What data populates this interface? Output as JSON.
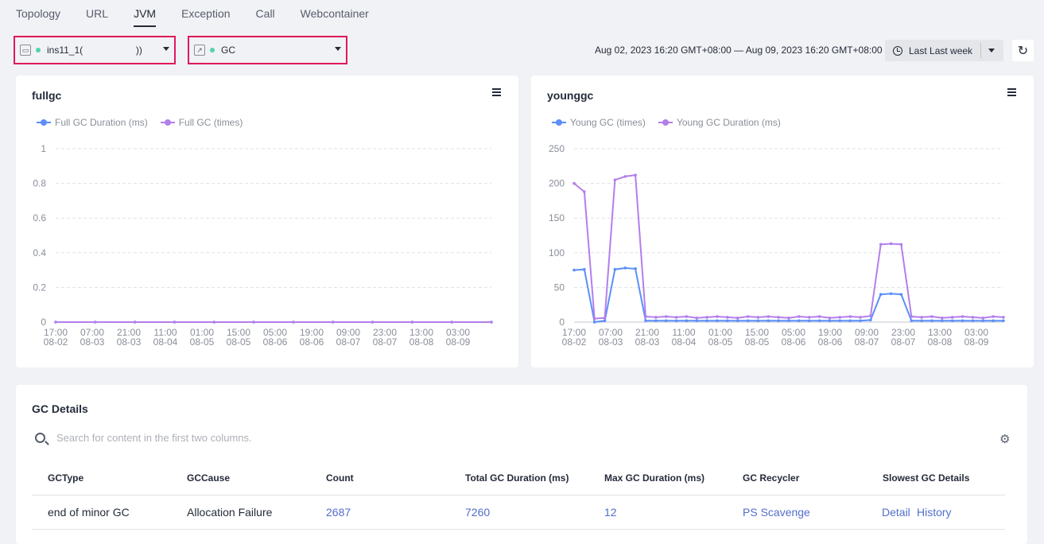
{
  "tabs": [
    {
      "label": "Topology"
    },
    {
      "label": "URL"
    },
    {
      "label": "JVM"
    },
    {
      "label": "Exception"
    },
    {
      "label": "Call"
    },
    {
      "label": "Webcontainer"
    }
  ],
  "active_tab": "JVM",
  "instance_select": {
    "value": "ins11_1(                    ))"
  },
  "metric_select": {
    "value": "GC"
  },
  "time": {
    "range": "Aug 02, 2023 16:20 GMT+08:00 — Aug 09, 2023 16:20 GMT+08:00",
    "preset": "Last Last week"
  },
  "chart_data": [
    {
      "type": "line",
      "title": "fullgc",
      "ylim": [
        0,
        1
      ],
      "yticks": [
        "0",
        "0.2",
        "0.4",
        "0.6",
        "0.8",
        "1"
      ],
      "xtick_times": [
        "17:00",
        "07:00",
        "21:00",
        "11:00",
        "01:00",
        "15:00",
        "05:00",
        "19:00",
        "09:00",
        "23:00",
        "13:00",
        "03:00"
      ],
      "xtick_dates": [
        "08-02",
        "08-03",
        "08-03",
        "08-04",
        "08-05",
        "08-05",
        "08-06",
        "08-06",
        "08-07",
        "08-07",
        "08-08",
        "08-09"
      ],
      "series": [
        {
          "name": "Full GC Duration (ms)",
          "color": "#5b8ff9",
          "values": [
            0,
            0,
            0,
            0,
            0,
            0,
            0,
            0,
            0,
            0,
            0,
            0
          ]
        },
        {
          "name": "Full GC (times)",
          "color": "#b37feb",
          "values": [
            0,
            0,
            0,
            0,
            0,
            0,
            0,
            0,
            0,
            0,
            0,
            0
          ]
        }
      ]
    },
    {
      "type": "line",
      "title": "younggc",
      "ylim": [
        0,
        250
      ],
      "yticks": [
        "0",
        "50",
        "100",
        "150",
        "200",
        "250"
      ],
      "xtick_times": [
        "17:00",
        "07:00",
        "21:00",
        "11:00",
        "01:00",
        "15:00",
        "05:00",
        "19:00",
        "09:00",
        "23:00",
        "13:00",
        "03:00"
      ],
      "xtick_dates": [
        "08-02",
        "08-03",
        "08-03",
        "08-04",
        "08-05",
        "08-05",
        "08-06",
        "08-06",
        "08-07",
        "08-07",
        "08-08",
        "08-09"
      ],
      "x_hours": [
        0,
        4,
        8,
        12,
        16,
        20,
        24,
        28,
        32,
        36,
        40,
        44,
        48,
        52,
        56,
        60,
        64,
        68,
        72,
        76,
        80,
        84,
        88,
        92,
        96,
        100,
        104,
        108,
        112,
        116,
        120,
        124,
        128,
        132,
        136,
        140,
        144,
        148,
        152,
        156,
        160,
        164,
        168
      ],
      "series": [
        {
          "name": "Young GC (times)",
          "color": "#5b8ff9",
          "values": [
            75,
            76,
            0,
            2,
            76,
            78,
            77,
            2,
            2,
            2,
            2,
            2,
            2,
            2,
            2,
            2,
            2,
            2,
            2,
            2,
            2,
            2,
            2,
            2,
            2,
            2,
            2,
            2,
            2,
            3,
            40,
            41,
            40,
            2,
            2,
            2,
            2,
            2,
            2,
            2,
            2,
            2,
            2
          ]
        },
        {
          "name": "Young GC Duration (ms)",
          "color": "#b37feb",
          "values": [
            200,
            188,
            5,
            6,
            205,
            210,
            212,
            8,
            7,
            8,
            7,
            8,
            6,
            7,
            8,
            7,
            6,
            8,
            7,
            8,
            7,
            6,
            8,
            7,
            8,
            6,
            7,
            8,
            7,
            9,
            112,
            113,
            112,
            8,
            7,
            8,
            6,
            7,
            8,
            7,
            6,
            8,
            7
          ]
        }
      ]
    }
  ],
  "gc_details": {
    "title": "GC Details",
    "search_placeholder": "Search for content in the first two columns.",
    "columns": [
      "GCType",
      "GCCause",
      "Count",
      "Total GC Duration (ms)",
      "Max GC Duration (ms)",
      "GC Recycler",
      "Slowest GC Details"
    ],
    "rows": [
      {
        "gctype": "end of minor GC",
        "gccause": "Allocation Failure",
        "count": "2687",
        "total": "7260",
        "max": "12",
        "recycler": "PS Scavenge",
        "detail": "Detail",
        "history": "History"
      }
    ]
  }
}
